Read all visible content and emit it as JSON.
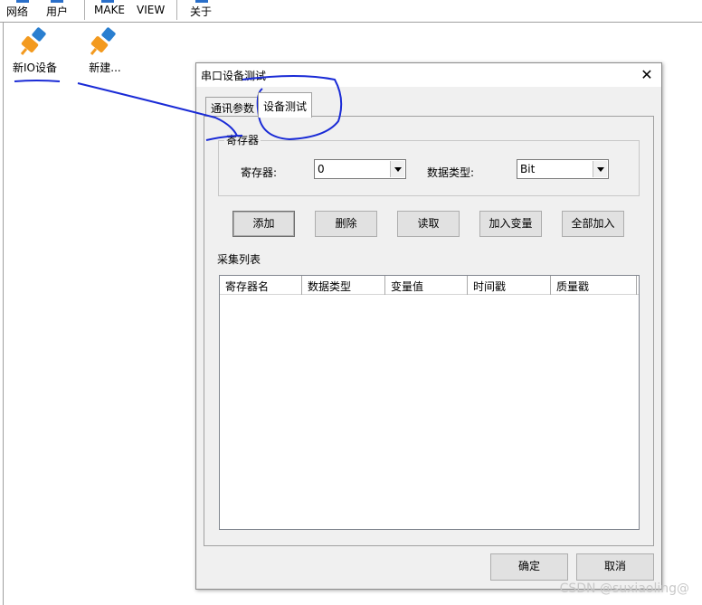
{
  "toolbar": {
    "items": [
      "网络",
      "用户",
      "MAKE",
      "VIEW",
      "关于"
    ]
  },
  "devices": [
    {
      "label": "新IO设备",
      "icon": "usb-plug-icon"
    },
    {
      "label": "新建...",
      "icon": "usb-plug-icon"
    }
  ],
  "dialog": {
    "title": "串口设备测试",
    "tabs": [
      {
        "label": "通讯参数",
        "active": false
      },
      {
        "label": "设备测试",
        "active": true
      }
    ],
    "group_title": "寄存器",
    "register_label": "寄存器:",
    "register_value": "0",
    "datatype_label": "数据类型:",
    "datatype_value": "Bit",
    "buttons": [
      "添加",
      "删除",
      "读取",
      "加入变量",
      "全部加入"
    ],
    "list_title": "采集列表",
    "columns": [
      "寄存器名",
      "数据类型",
      "变量值",
      "时间戳",
      "质量戳"
    ],
    "ok_label": "确定",
    "cancel_label": "取消"
  },
  "watermark": "CSDN @suxiaoling@",
  "colors": {
    "annotation_ink": "#1a2bd6",
    "icon_orange": "#f39a1f",
    "icon_blue": "#2a7fd0"
  }
}
